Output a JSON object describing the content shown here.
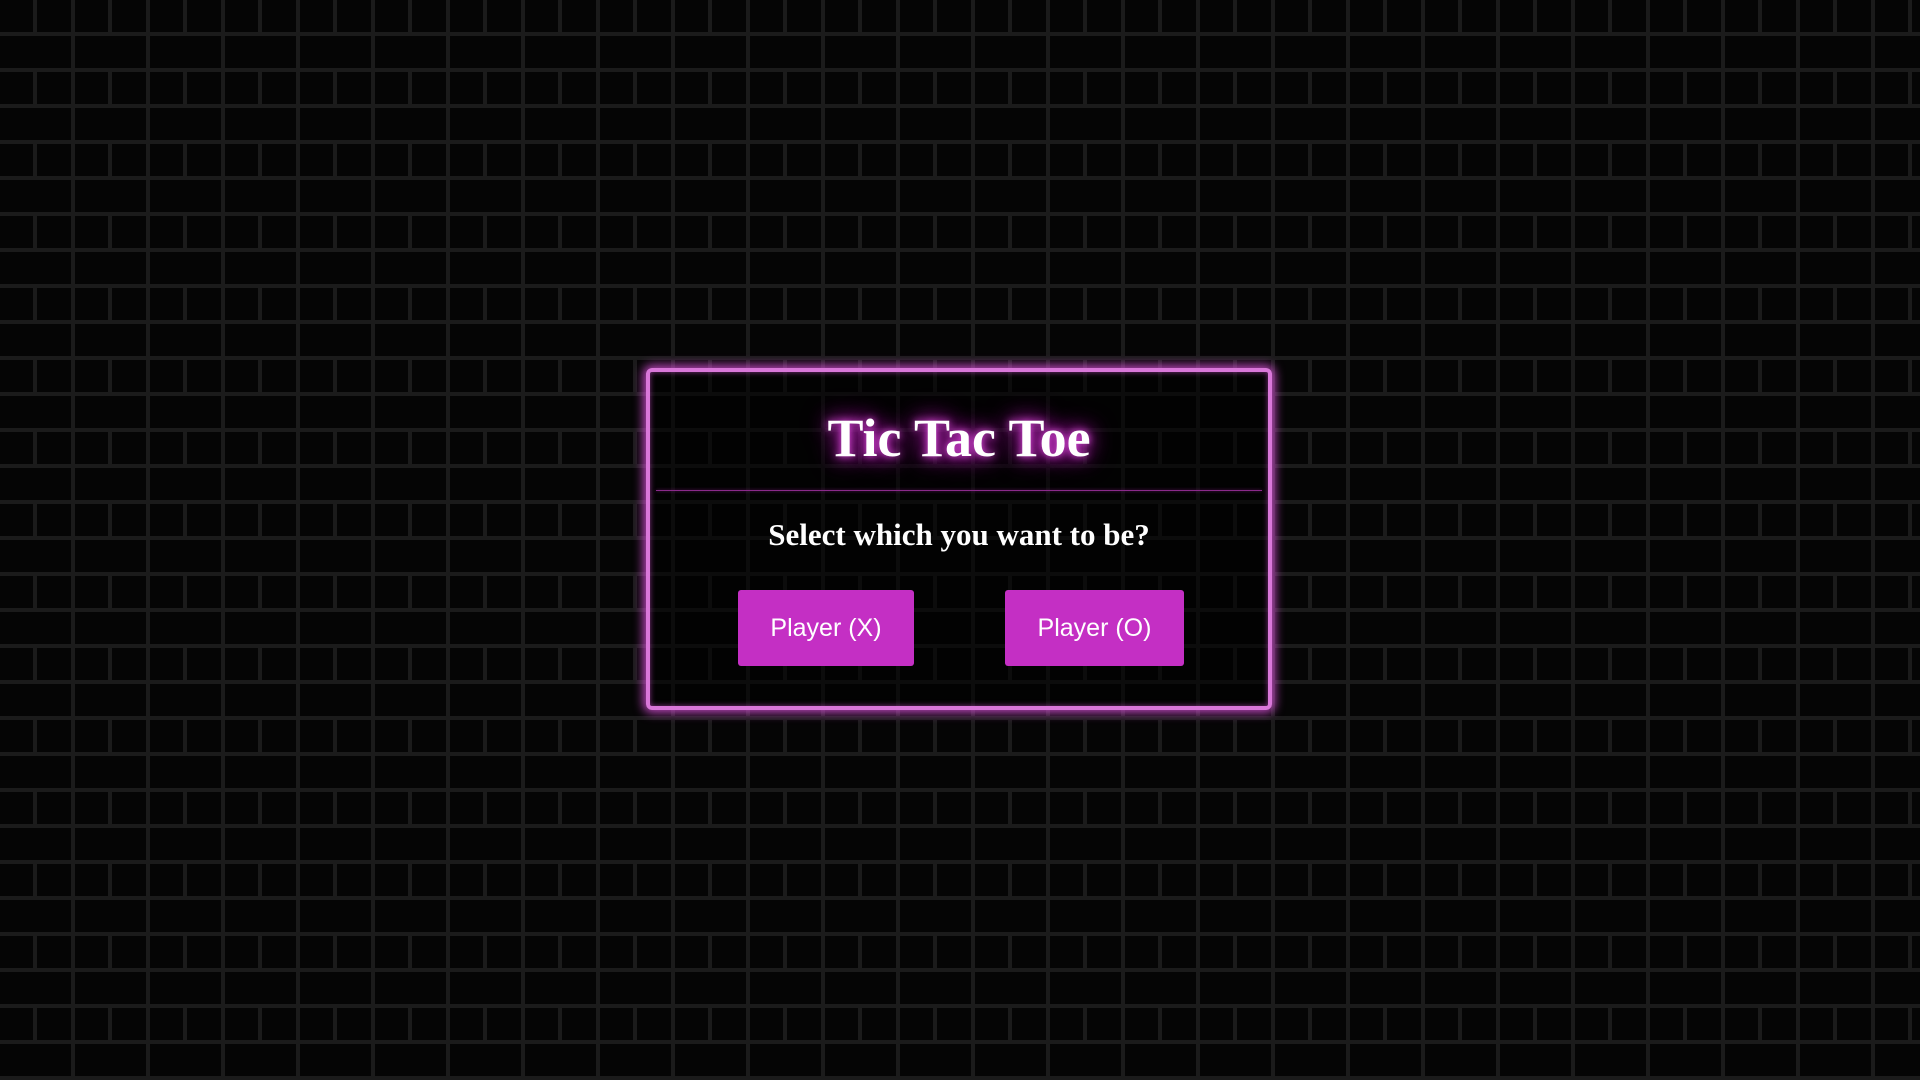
{
  "dialog": {
    "title": "Tic Tac Toe",
    "prompt": "Select which you want to be?",
    "buttons": {
      "player_x": "Player (X)",
      "player_o": "Player (O)"
    }
  },
  "colors": {
    "accent": "#c42fc4",
    "neon_border": "#d977d9",
    "background": "#050505",
    "brick_mortar": "#1b1b1b",
    "text": "#ffffff"
  }
}
